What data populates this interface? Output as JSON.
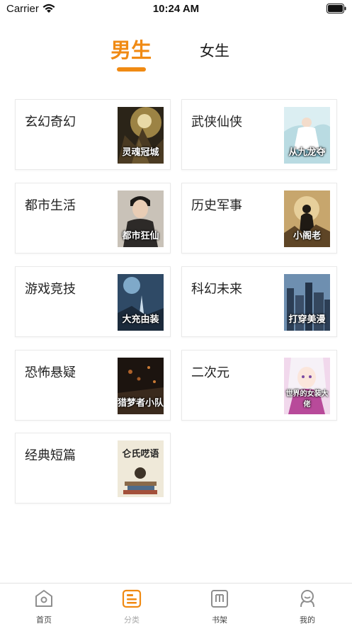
{
  "status_bar": {
    "carrier": "Carrier",
    "time": "10:24 AM"
  },
  "tabs": {
    "male": "男生",
    "female": "女生",
    "active": "male",
    "accent_color": "#f08a13"
  },
  "categories": [
    {
      "label": "玄幻奇幻",
      "cover_title": "灵魂冠城"
    },
    {
      "label": "武侠仙侠",
      "cover_title": "从九龙夺"
    },
    {
      "label": "都市生活",
      "cover_title": "都市狂仙"
    },
    {
      "label": "历史军事",
      "cover_title": "小阁老"
    },
    {
      "label": "游戏竞技",
      "cover_title": "大充由装"
    },
    {
      "label": "科幻未来",
      "cover_title": "打穿美漫"
    },
    {
      "label": "恐怖悬疑",
      "cover_title": "猎梦者小队"
    },
    {
      "label": "二次元",
      "cover_title": "世界的女装大佬"
    },
    {
      "label": "经典短篇",
      "cover_title": "仑氏呓语"
    }
  ],
  "tab_bar": {
    "items": [
      {
        "label": "首页",
        "icon": "home-icon"
      },
      {
        "label": "分类",
        "icon": "category-icon",
        "active": true
      },
      {
        "label": "书架",
        "icon": "bookshelf-icon"
      },
      {
        "label": "我的",
        "icon": "profile-icon"
      }
    ]
  }
}
